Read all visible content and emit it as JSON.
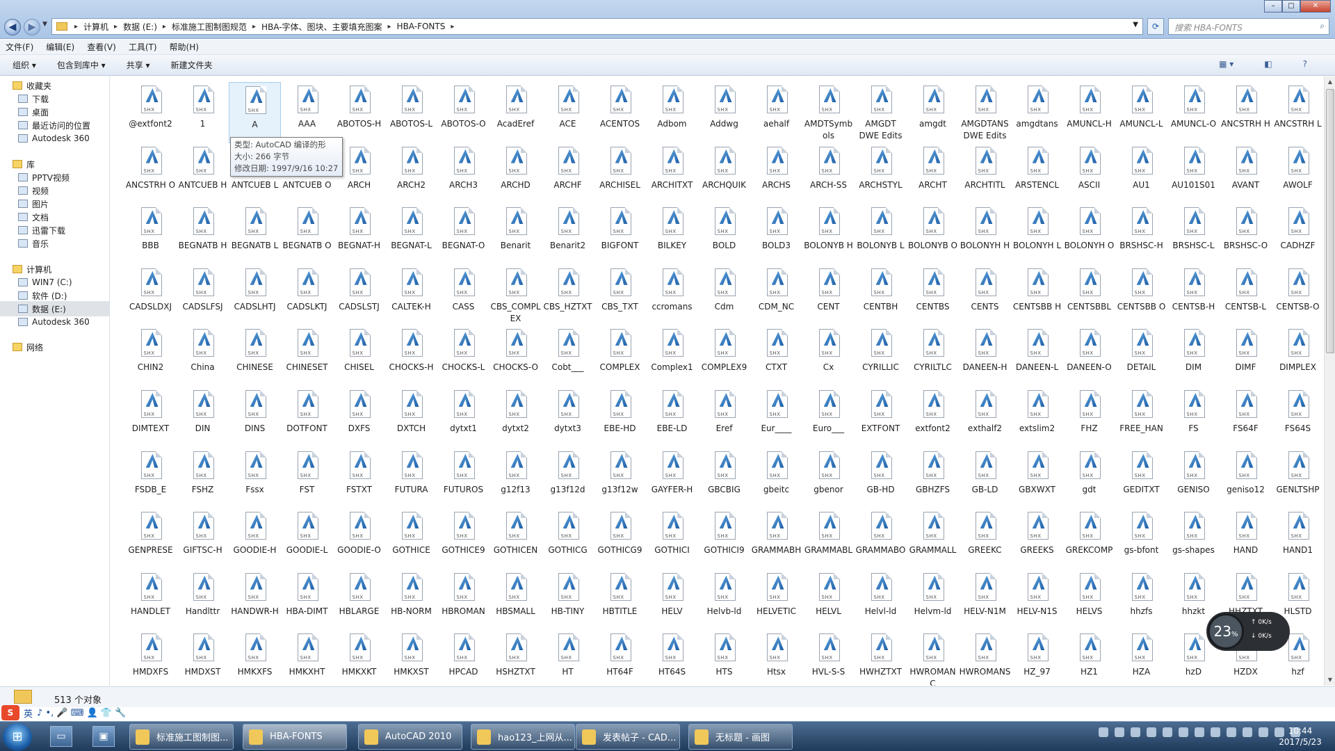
{
  "window": {
    "address_path": [
      "计算机",
      "数据 (E:)",
      "标准施工图制图规范",
      "HBA-字体、图块、主要填充图案",
      "HBA-FONTS"
    ],
    "search_placeholder": "搜索 HBA-FONTS"
  },
  "menu": [
    "文件(F)",
    "编辑(E)",
    "查看(V)",
    "工具(T)",
    "帮助(H)"
  ],
  "commands": [
    "组织 ▾",
    "包含到库中 ▾",
    "共享 ▾",
    "新建文件夹"
  ],
  "sidebar": [
    {
      "label": "收藏夹",
      "head": true
    },
    {
      "label": "下载"
    },
    {
      "label": "桌面"
    },
    {
      "label": "最近访问的位置"
    },
    {
      "label": "Autodesk 360"
    },
    {
      "label": "库",
      "head": true
    },
    {
      "label": "PPTV视频"
    },
    {
      "label": "视频"
    },
    {
      "label": "图片"
    },
    {
      "label": "文档"
    },
    {
      "label": "迅雷下载"
    },
    {
      "label": "音乐"
    },
    {
      "label": "计算机",
      "head": true
    },
    {
      "label": "WIN7 (C:)"
    },
    {
      "label": "软件 (D:)"
    },
    {
      "label": "数据 (E:)",
      "selected": true
    },
    {
      "label": "Autodesk 360"
    },
    {
      "label": "网络",
      "head": true
    }
  ],
  "icon_tag": "SHX",
  "files": [
    "@extfont2",
    "1",
    "A",
    "AAA",
    "ABOTOS-H",
    "ABOTOS-L",
    "ABOTOS-O",
    "AcadEref",
    "ACE",
    "ACENTOS",
    "Adbom",
    "Addwg",
    "aehalf",
    "AMDTSymbols",
    "AMGDT DWE Edits",
    "amgdt",
    "AMGDTANS DWE Edits",
    "amgdtans",
    "AMUNCL-H",
    "AMUNCL-L",
    "AMUNCL-O",
    "ANCSTRH H",
    "ANCSTRH L",
    "ANCSTRH O",
    "ANTCUEB H",
    "ANTCUEB L",
    "ANTCUEB O",
    "ARCH",
    "ARCH2",
    "ARCH3",
    "ARCHD",
    "ARCHF",
    "ARCHISEL",
    "ARCHITXT",
    "ARCHQUIK",
    "ARCHS",
    "ARCH-SS",
    "ARCHSTYL",
    "ARCHT",
    "ARCHTITL",
    "ARSTENCL",
    "ASCII",
    "AU1",
    "AU101S01",
    "AVANT",
    "AWOLF",
    "BBB",
    "BEGNATB H",
    "BEGNATB L",
    "BEGNATB O",
    "BEGNAT-H",
    "BEGNAT-L",
    "BEGNAT-O",
    "Benarit",
    "Benarit2",
    "BIGFONT",
    "BILKEY",
    "BOLD",
    "BOLD3",
    "BOLONYB H",
    "BOLONYB L",
    "BOLONYB O",
    "BOLONYH H",
    "BOLONYH L",
    "BOLONYH O",
    "BRSHSC-H",
    "BRSHSC-L",
    "BRSHSC-O",
    "CADHZF",
    "CADSLDXJ",
    "CADSLFSJ",
    "CADSLHTJ",
    "CADSLKTJ",
    "CADSLSTJ",
    "CALTEK-H",
    "CASS",
    "CBS_COMPLEX",
    "CBS_HZTXT",
    "CBS_TXT",
    "ccromans",
    "Cdm",
    "CDM_NC",
    "CENT",
    "CENTBH",
    "CENTBS",
    "CENTS",
    "CENTSBB H",
    "CENTSBBL",
    "CENTSBB O",
    "CENTSB-H",
    "CENTSB-L",
    "CENTSB-O",
    "CHIN2",
    "China",
    "CHINESE",
    "CHINESET",
    "CHISEL",
    "CHOCKS-H",
    "CHOCKS-L",
    "CHOCKS-O",
    "Cobt___",
    "COMPLEX",
    "Complex1",
    "COMPLEX9",
    "CTXT",
    "Cx",
    "CYRILLIC",
    "CYRILTLC",
    "DANEEN-H",
    "DANEEN-L",
    "DANEEN-O",
    "DETAIL",
    "DIM",
    "DIMF",
    "DIMPLEX",
    "DIMTEXT",
    "DIN",
    "DINS",
    "DOTFONT",
    "DXFS",
    "DXTCH",
    "dytxt1",
    "dytxt2",
    "dytxt3",
    "EBE-HD",
    "EBE-LD",
    "Eref",
    "Eur____",
    "Euro___",
    "EXTFONT",
    "extfont2",
    "exthalf2",
    "extslim2",
    "FHZ",
    "FREE_HAN",
    "FS",
    "FS64F",
    "FS64S",
    "FSDB_E",
    "FSHZ",
    "Fssx",
    "FST",
    "FSTXT",
    "FUTURA",
    "FUTUROS",
    "g12f13",
    "g13f12d",
    "g13f12w",
    "GAYFER-H",
    "GBCBIG",
    "gbeitc",
    "gbenor",
    "GB-HD",
    "GBHZFS",
    "GB-LD",
    "GBXWXT",
    "gdt",
    "GEDITXT",
    "GENISO",
    "geniso12",
    "GENLTSHP",
    "GENPRESE",
    "GIFTSC-H",
    "GOODIE-H",
    "GOODIE-L",
    "GOODIE-O",
    "GOTHICE",
    "GOTHICE9",
    "GOTHICEN",
    "GOTHICG",
    "GOTHICG9",
    "GOTHICI",
    "GOTHICI9",
    "GRAMMABH",
    "GRAMMABL",
    "GRAMMABO",
    "GRAMMALL",
    "GREEKC",
    "GREEKS",
    "GREKCOMP",
    "gs-bfont",
    "gs-shapes",
    "HAND",
    "HAND1",
    "HANDLET",
    "Handlttr",
    "HANDWR-H",
    "HBA-DIMT",
    "HBLARGE",
    "HB-NORM",
    "HBROMAN",
    "HBSMALL",
    "HB-TINY",
    "HBTITLE",
    "HELV",
    "Helvb-ld",
    "HELVETIC",
    "HELVL",
    "Helvl-ld",
    "Helvm-ld",
    "HELV-N1M",
    "HELV-N1S",
    "HELVS",
    "hhzfs",
    "hhzkt",
    "HHZTXT",
    "HLSTD",
    "HMDXFS",
    "HMDXST",
    "HMKXFS",
    "HMKXHT",
    "HMKXKT",
    "HMKXST",
    "HPCAD",
    "HSHZTXT",
    "HT",
    "HT64F",
    "HT64S",
    "HTS",
    "Htsx",
    "HVL-S-S",
    "HWHZTXT",
    "HWROMANC",
    "HWROMANS",
    "HZ_97",
    "HZ1",
    "HZA",
    "hzD",
    "HZDX",
    "hzf"
  ],
  "tooltip": {
    "type_line": "类型: AutoCAD 编译的形",
    "size_line": "大小: 266 字节",
    "date_line": "修改日期: 1997/9/16 10:27"
  },
  "status": {
    "count": "513 个对象"
  },
  "ime": {
    "logo": "S",
    "lang": "英",
    "tools": "♪ •, 🎤 ⌨ 👤 👕 🔧"
  },
  "net_widget": {
    "percent": "23",
    "unit": "%",
    "up": "0K/s",
    "down": "0K/s"
  },
  "taskbar": {
    "tasks": [
      "标准施工图制图...",
      "HBA-FONTS",
      "AutoCAD 2010",
      "hao123_上网从...",
      "发表帖子 - CAD...",
      "无标题 - 画图"
    ],
    "time": "10:44",
    "date": "2017/5/23"
  }
}
